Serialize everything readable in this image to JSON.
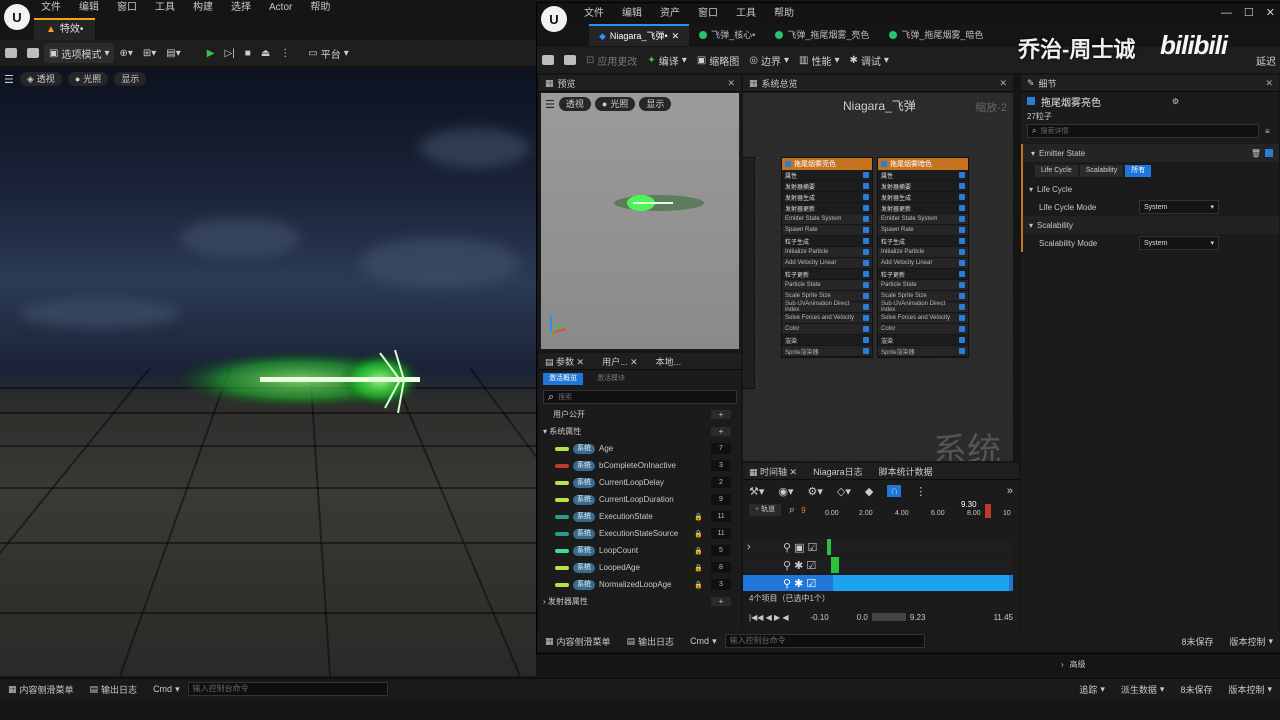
{
  "main": {
    "logo": "U",
    "menu": [
      "文件",
      "编辑",
      "窗口",
      "工具",
      "构建",
      "选择",
      "Actor",
      "帮助"
    ],
    "tab_label": "特效•",
    "toolbar": {
      "mode_label": "选项模式",
      "platform_label": "平台"
    },
    "viewport_chips": [
      "透视",
      "光照",
      "显示"
    ]
  },
  "bottom_bar": {
    "content_drawer": "内容侧滑菜单",
    "output_log": "输出日志",
    "cmd": "Cmd",
    "cmd_placeholder": "输入控制台命令",
    "trace": "追踪",
    "derived_data": "派生数据",
    "unsaved": "8未保存",
    "source_control": "版本控制"
  },
  "niagara": {
    "logo": "U",
    "menu": [
      "文件",
      "编辑",
      "资产",
      "窗口",
      "工具",
      "帮助"
    ],
    "tabs": [
      {
        "label": "Niagara_飞弹•",
        "active": true
      },
      {
        "label": "飞弹_核心•",
        "active": false
      },
      {
        "label": "飞弹_拖尾烟雾_亮色",
        "active": false
      },
      {
        "label": "飞弹_拖尾烟雾_暗色",
        "active": false
      }
    ],
    "toolbar": [
      "应用更改",
      "编译",
      "缩略图",
      "边界",
      "性能",
      "调试",
      "延迟"
    ],
    "preview": {
      "title": "预览",
      "chips": [
        "透视",
        "光照",
        "显示"
      ]
    },
    "system_overview": {
      "title": "系统总览",
      "graph_title": "Niagara_飞弹",
      "zoom": "缩放-2",
      "watermark": "系统",
      "nodes": [
        {
          "title": "拖尾烟雾亮色",
          "rows": [
            "属性",
            "发射器摘要",
            "发射器生成",
            "发射器更新",
            "Emitter State  System",
            "Spawn Rate",
            "粒子生成",
            "Initialize Particle",
            "Add Velocity  Linear",
            "粒子更新",
            "Particle State",
            "Scale Sprite Size",
            "Sub UVAnimation  Direct index",
            "Solve Forces and Velocity",
            "Color",
            "渲染",
            "Sprite渲染器"
          ]
        },
        {
          "title": "拖尾烟雾暗色",
          "rows": [
            "属性",
            "发射器摘要",
            "发射器生成",
            "发射器更新",
            "Emitter State  System",
            "Spawn Rate",
            "粒子生成",
            "Initialize Particle",
            "Add Velocity  Linear",
            "粒子更新",
            "Particle State",
            "Scale Sprite Size",
            "Sub UVAnimation  Direct index",
            "Solve Forces and Velocity",
            "Color",
            "渲染",
            "Sprite渲染器"
          ]
        }
      ]
    },
    "details": {
      "title": "细节",
      "emitter_name": "拖尾烟雾亮色",
      "particles": "27粒子",
      "search_placeholder": "搜索详情",
      "section": "Emitter State",
      "filters": [
        "Life Cycle",
        "Scalability",
        "所有"
      ],
      "groups": [
        {
          "name": "Life Cycle",
          "prop": "Life Cycle Mode",
          "value": "System"
        },
        {
          "name": "Scalability",
          "prop": "Scalability Mode",
          "value": "System"
        }
      ],
      "advanced": "高级"
    },
    "params": {
      "tabs": [
        "参数",
        "用户...",
        "本地..."
      ],
      "subtabs": [
        "激活概览",
        "激活模块"
      ],
      "search_placeholder": "搜索",
      "user_exposed": "用户公开",
      "system_attrs": "系统属性",
      "emitter_attrs": "发射器属性",
      "chip": "系统",
      "items": [
        {
          "name": "Age",
          "value": "7",
          "color": "#b7e34a",
          "locked": false
        },
        {
          "name": "bCompleteOnInactive",
          "value": "3",
          "color": "#c0392b",
          "locked": false
        },
        {
          "name": "CurrentLoopDelay",
          "value": "2",
          "color": "#b7e34a",
          "locked": false
        },
        {
          "name": "CurrentLoopDuration",
          "value": "9",
          "color": "#b7e34a",
          "locked": false
        },
        {
          "name": "ExecutionState",
          "value": "11",
          "color": "#2a9d8f",
          "locked": true
        },
        {
          "name": "ExecutionStateSource",
          "value": "11",
          "color": "#2a9d8f",
          "locked": true
        },
        {
          "name": "LoopCount",
          "value": "5",
          "color": "#3ddc97",
          "locked": true
        },
        {
          "name": "LoopedAge",
          "value": "8",
          "color": "#b7e34a",
          "locked": true
        },
        {
          "name": "NormalizedLoopAge",
          "value": "3",
          "color": "#b7e34a",
          "locked": true
        }
      ]
    },
    "timeline": {
      "tabs": [
        "时间轴",
        "Niagara日志",
        "脚本统计数据"
      ],
      "add_track": "轨道",
      "frame": "9",
      "playhead": "9.30",
      "ticks": [
        "0.00",
        "2.00",
        "4.00",
        "6.00",
        "8.00",
        "10"
      ],
      "status": "4个项目（已选中1个）",
      "range_start": "-0.10",
      "range_a": "0.0",
      "range_b": "9.23",
      "range_end": "11.45"
    },
    "bottom": {
      "content_drawer": "内容侧滑菜单",
      "output_log": "输出日志",
      "cmd": "Cmd",
      "cmd_placeholder": "输入控制台命令",
      "unsaved": "8未保存",
      "source_control": "版本控制"
    }
  },
  "watermark": {
    "author": "乔治-周士诚",
    "site": "bilibili"
  }
}
